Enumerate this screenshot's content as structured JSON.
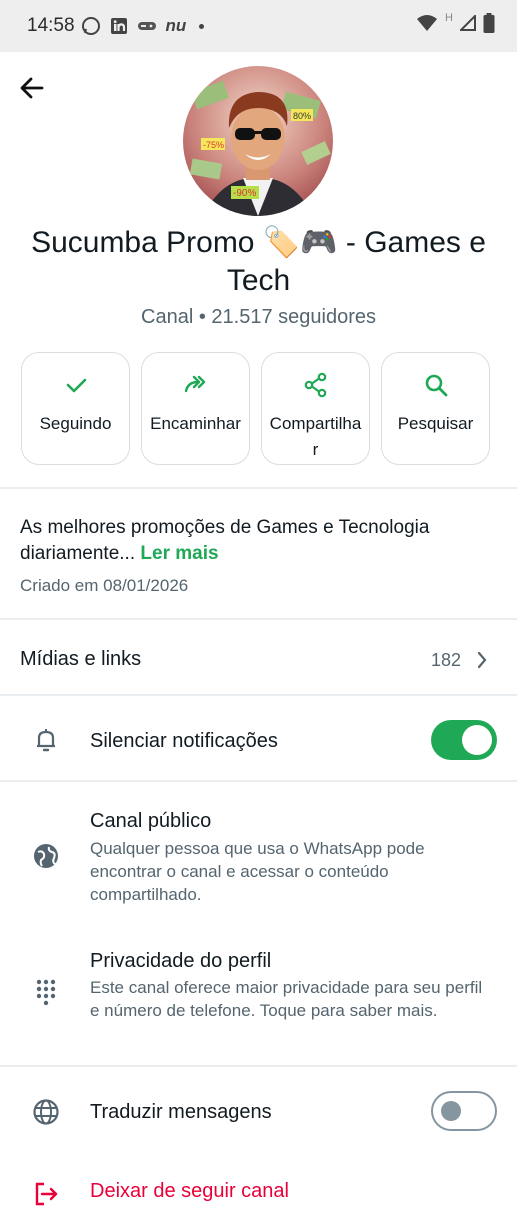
{
  "status_bar": {
    "time": "14:58",
    "notification_icons": [
      "whatsapp-icon",
      "linkedin-icon",
      "game-controller-icon",
      "nubank-icon",
      "dot-icon"
    ],
    "nu_text": "nu",
    "network_label": "H",
    "system_icons": [
      "wifi-icon",
      "signal-icon",
      "battery-icon"
    ]
  },
  "header": {
    "back_icon": "arrow-left-icon"
  },
  "channel": {
    "name": "Sucumba Promo 🏷️🎮  - Games e Tech",
    "type": "Canal",
    "separator": "•",
    "followers": "21.517 seguidores",
    "avatar_badges": [
      "80%",
      "-75%",
      "-90%"
    ]
  },
  "actions": [
    {
      "label": "Seguindo",
      "icon": "check-icon"
    },
    {
      "label": "Encaminhar",
      "icon": "forward-icon"
    },
    {
      "label": "Compartilhar",
      "icon": "share-icon"
    },
    {
      "label": "Pesquisar",
      "icon": "search-icon"
    }
  ],
  "description": {
    "text": "As melhores promoções de Games e Tecnologia diariamente...",
    "read_more": "Ler mais",
    "created": "Criado em 08/01/2026"
  },
  "media": {
    "label": "Mídias e links",
    "count": "182"
  },
  "settings": {
    "mute": {
      "label": "Silenciar notificações",
      "enabled": true
    },
    "public": {
      "label": "Canal público",
      "sub": "Qualquer pessoa que usa o WhatsApp pode encontrar o canal e acessar o conteúdo compartilhado."
    },
    "privacy": {
      "label": "Privacidade do perfil",
      "sub": "Este canal oferece maior privacidade para seu perfil e número de telefone. Toque para saber mais."
    },
    "translate": {
      "label": "Traduzir mensagens",
      "enabled": false
    },
    "unfollow": {
      "label": "Deixar de seguir canal"
    }
  },
  "colors": {
    "accent": "#1fa855",
    "danger": "#ea0038",
    "text": "#111b21",
    "secondary": "#54656f"
  }
}
